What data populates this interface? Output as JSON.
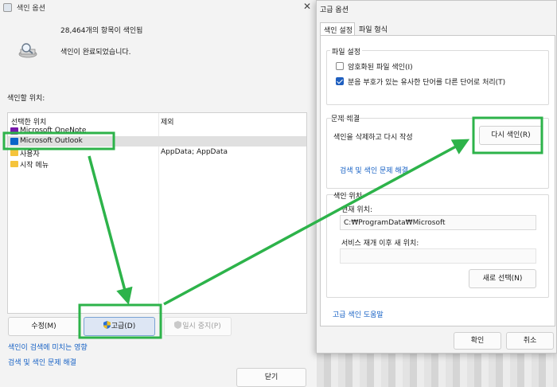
{
  "back_window": {
    "title": "색인 옵션",
    "item_count": "28,464개의 항목이 색인됨",
    "status": "색인이 완료되었습니다.",
    "locations_label": "색인할 위치:",
    "columns": {
      "included": "선택한 위치",
      "excluded": "제외"
    },
    "locations": [
      {
        "name": "Microsoft OneNote",
        "exclude": "",
        "icon": "onenote-icon"
      },
      {
        "name": "Microsoft Outlook",
        "exclude": "",
        "icon": "outlook-icon"
      },
      {
        "name": "사용자",
        "exclude": "AppData; AppData",
        "icon": "folder-icon"
      },
      {
        "name": "시작 메뉴",
        "exclude": "",
        "icon": "folder-icon"
      }
    ],
    "buttons": {
      "modify": "수정(M)",
      "advanced": "고급(D)",
      "pause": "일시 중지(P)",
      "close": "닫기"
    },
    "links": {
      "effect": "색인이 검색에 미치는 영향",
      "troubleshoot": "검색 및 색인 문제 해결"
    }
  },
  "front_window": {
    "title": "고급 옵션",
    "tabs": [
      "색인 설정",
      "파일 형식"
    ],
    "settings_group": {
      "title": "파일 설정",
      "encrypt_label": "암호화된 파일 색인(I)",
      "encrypt_checked": false,
      "diacritics_label": "분음 부호가 있는 유사한 단어를 다른 단어로 처리(T)",
      "diacritics_checked": true
    },
    "trouble_group": {
      "title": "문제 해결",
      "rebuild_text": "색인을 삭제하고 다시 작성",
      "rebuild_button": "다시 색인(R)",
      "link": "검색 및 색인 문제 해결"
    },
    "location_group": {
      "title": "색인 위치",
      "current_label": "현재 위치:",
      "current_value": "C:₩ProgramData₩Microsoft",
      "new_label": "서비스 재개 이후 새 위치:",
      "new_value": "",
      "select_button": "새로 선택(N)"
    },
    "help_link": "고급 색인 도움말",
    "ok": "확인",
    "cancel": "취소"
  },
  "colors": {
    "annotation": "#2db34a",
    "link": "#1560c4",
    "selection": "#e0e0e0"
  }
}
